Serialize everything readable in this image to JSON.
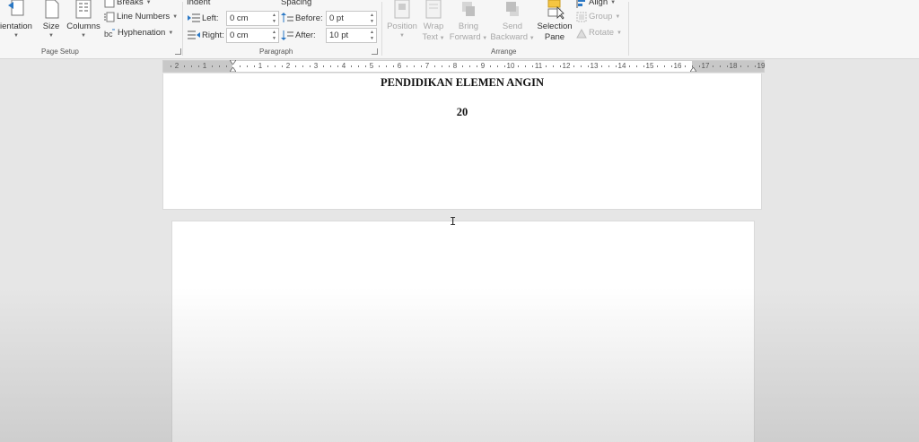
{
  "ribbon": {
    "page_setup": {
      "orientation_label": "ientation",
      "size_label": "Size",
      "columns_label": "Columns",
      "breaks_label": "Breaks",
      "line_numbers_label": "Line Numbers",
      "hyphenation_label": "Hyphenation",
      "group_label": "Page Setup"
    },
    "paragraph": {
      "indent_title": "Indent",
      "spacing_title": "Spacing",
      "left_label": "Left:",
      "left_value": "0 cm",
      "right_label": "Right:",
      "right_value": "0 cm",
      "before_label": "Before:",
      "before_value": "0 pt",
      "after_label": "After:",
      "after_value": "10 pt",
      "group_label": "Paragraph"
    },
    "arrange": {
      "position_label": "Position",
      "wrap_label_1": "Wrap",
      "wrap_label_2": "Text",
      "bring_label_1": "Bring",
      "bring_label_2": "Forward",
      "send_label_1": "Send",
      "send_label_2": "Backward",
      "selection_label_1": "Selection",
      "selection_label_2": "Pane",
      "align_label": "Align",
      "group_btn_label": "Group",
      "rotate_label": "Rotate",
      "group_label": "Arrange"
    }
  },
  "ruler": {
    "labels_left": [
      "2",
      "1"
    ],
    "labels_right": [
      "1",
      "2",
      "3",
      "4",
      "5",
      "6",
      "7",
      "8",
      "9",
      "10",
      "11",
      "12",
      "13",
      "14",
      "15",
      "16"
    ],
    "labels_margin_right": [
      "17",
      "18",
      "19"
    ]
  },
  "document": {
    "heading": "PENDIDIKAN ELEMEN ANGIN",
    "number": "20"
  }
}
